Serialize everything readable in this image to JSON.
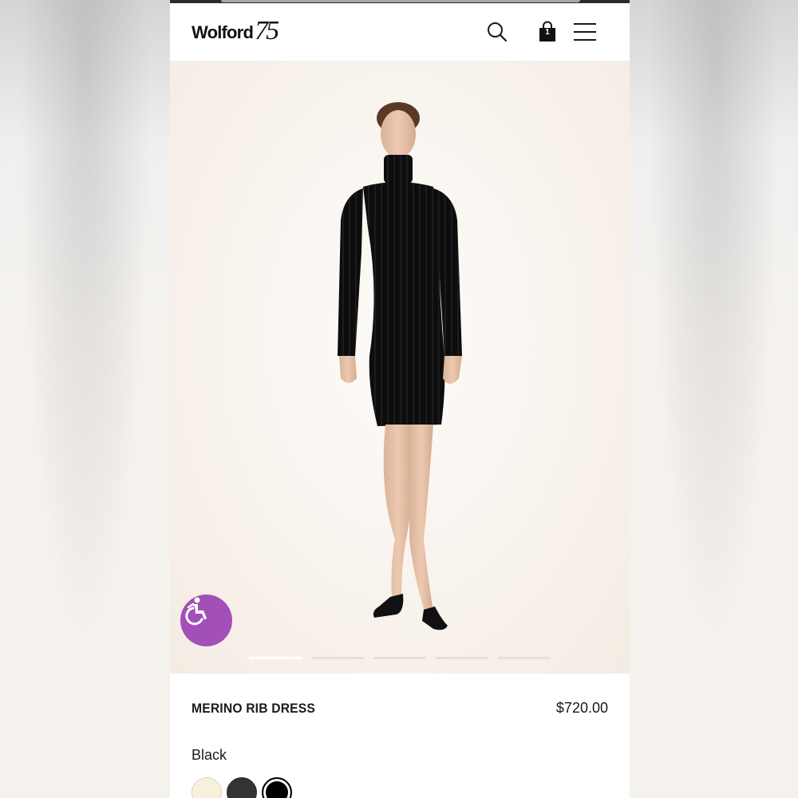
{
  "header": {
    "brand_name": "Wolford",
    "brand_number": "75",
    "cart_count": "1",
    "icons": [
      "search-icon",
      "shopping-bag-icon",
      "hamburger-menu-icon"
    ]
  },
  "gallery": {
    "total_images": 5,
    "active_index": 0,
    "accessibility_icon": "wheelchair-accessibility-icon",
    "accessibility_color": "#a24fb8"
  },
  "product": {
    "name": "MERINO RIB DRESS",
    "price": "$720.00",
    "selected_color": "Black",
    "colors": [
      {
        "swatch": "#f6f0dc",
        "selected": false
      },
      {
        "swatch": "#333333",
        "selected": false
      },
      {
        "swatch": "#000000",
        "selected": true
      }
    ]
  }
}
